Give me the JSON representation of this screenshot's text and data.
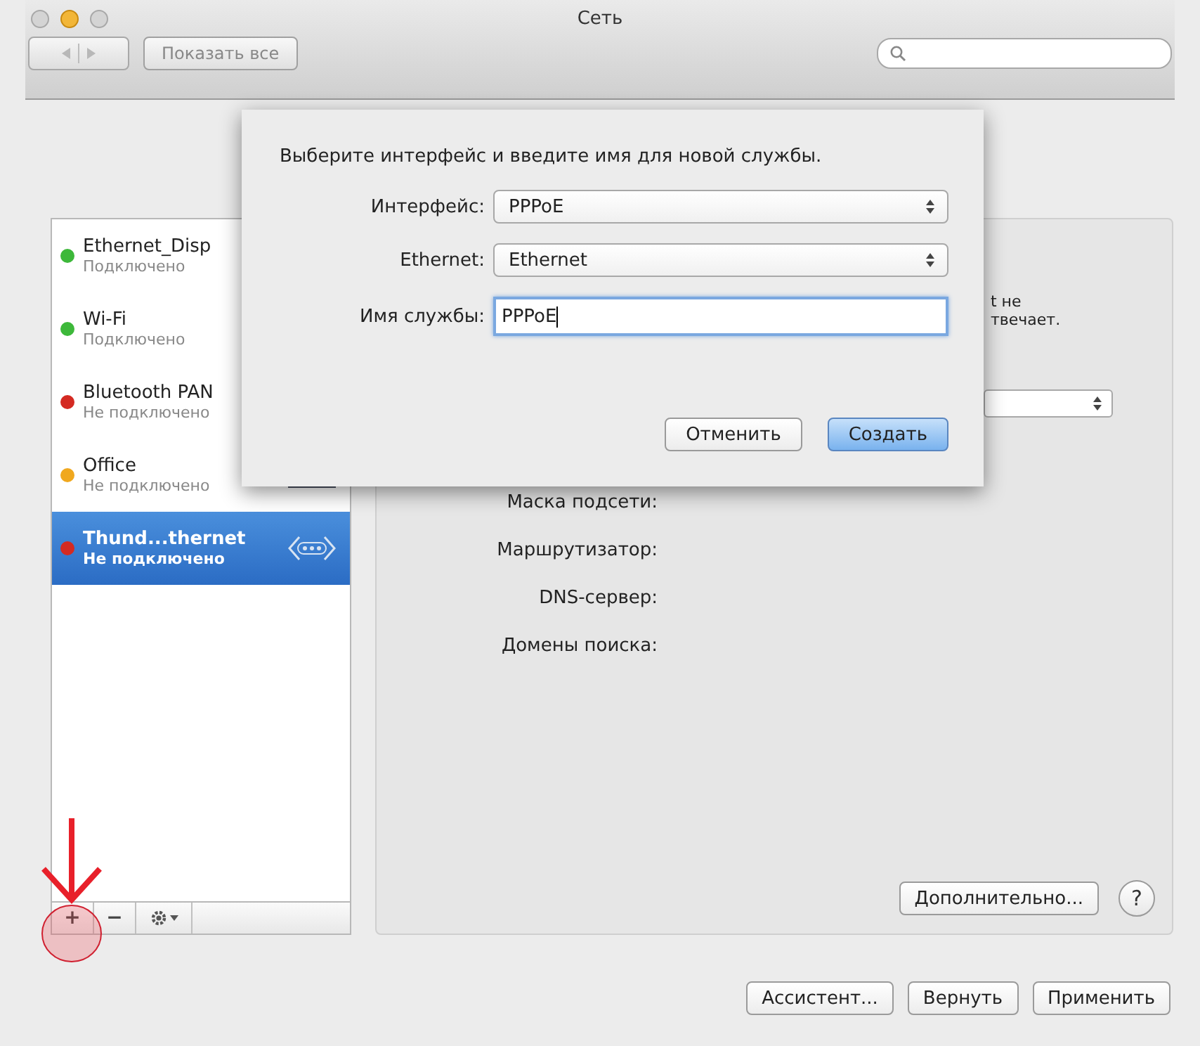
{
  "window": {
    "title": "Сеть"
  },
  "toolbar": {
    "show_all_button": "Показать все"
  },
  "services": [
    {
      "name": "Ethernet_Disp",
      "status": "Подключено",
      "color": "#3db83a",
      "selected": false
    },
    {
      "name": "Wi-Fi",
      "status": "Подключено",
      "color": "#3db83a",
      "selected": false
    },
    {
      "name": "Bluetooth PAN",
      "status": "Не подключено",
      "color": "#d42a22",
      "selected": false
    },
    {
      "name": "Office",
      "status": "Не подключено",
      "color": "#f0a81e",
      "selected": false,
      "kind": "vpn"
    },
    {
      "name": "Thund...thernet",
      "status": "Не подключено",
      "color": "#d42a22",
      "selected": true,
      "kind": "thunderbolt"
    }
  ],
  "list_toolbar": {
    "add": "+",
    "remove": "−"
  },
  "detail": {
    "partial_lines": [
      "t не",
      "твечает."
    ],
    "labels": [
      "Маска подсети:",
      "Маршрутизатор:",
      "DNS-сервер:",
      "Домены поиска:"
    ],
    "advanced_button": "Дополнительно...",
    "help_button": "?"
  },
  "footer_buttons": [
    "Ассистент...",
    "Вернуть",
    "Применить"
  ],
  "dialog": {
    "prompt": "Выберите интерфейс и введите имя для новой службы.",
    "fields": [
      {
        "label": "Интерфейс:",
        "value": "PPPoE",
        "kind": "select"
      },
      {
        "label": "Ethernet:",
        "value": "Ethernet",
        "kind": "select"
      },
      {
        "label": "Имя службы:",
        "value": "PPPoE",
        "kind": "text"
      }
    ],
    "buttons": [
      {
        "label": "Отменить",
        "default": false
      },
      {
        "label": "Создать",
        "default": true
      }
    ]
  }
}
